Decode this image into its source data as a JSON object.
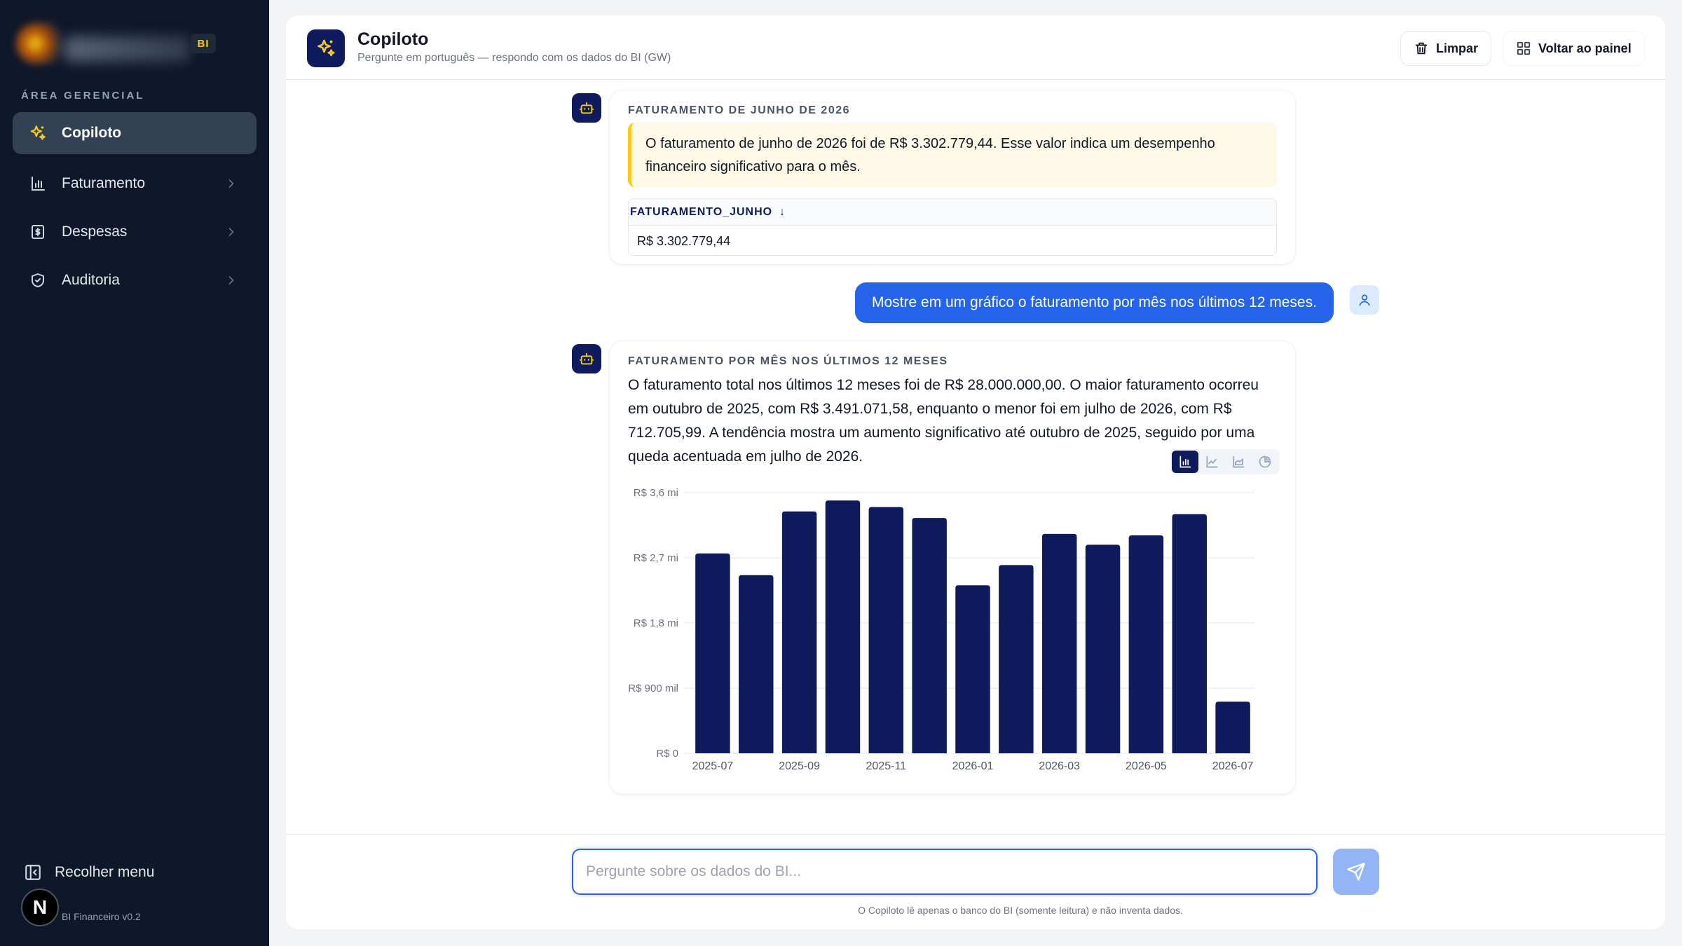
{
  "sidebar": {
    "badge": "BI",
    "section_label": "ÁREA GERENCIAL",
    "items": [
      {
        "label": "Copiloto",
        "icon": "sparkles-icon",
        "active": true
      },
      {
        "label": "Faturamento",
        "icon": "bar-chart-icon",
        "active": false
      },
      {
        "label": "Despesas",
        "icon": "receipt-icon",
        "active": false
      },
      {
        "label": "Auditoria",
        "icon": "shield-check-icon",
        "active": false
      }
    ],
    "collapse_label": "Recolher menu",
    "version": "BI Financeiro v0.2",
    "n_badge": "N"
  },
  "header": {
    "title": "Copiloto",
    "subtitle": "Pergunte em português — respondo com os dados do BI (GW)",
    "clear_label": "Limpar",
    "back_label": "Voltar ao painel"
  },
  "messages": {
    "first": {
      "label": "FATURAMENTO DE JUNHO DE 2026",
      "text": "O faturamento de junho de 2026 foi de R$ 3.302.779,44. Esse valor indica um desempenho financeiro significativo para o mês.",
      "table_header": "FATURAMENTO_JUNHO",
      "sort_indicator": "↓",
      "table_value": "R$ 3.302.779,44"
    },
    "user": {
      "text": "Mostre em um gráfico o faturamento por mês nos últimos 12 meses."
    },
    "second": {
      "label": "FATURAMENTO POR MÊS NOS ÚLTIMOS 12 MESES",
      "text": "O faturamento total nos últimos 12 meses foi de R$ 28.000.000,00. O maior faturamento ocorreu em outubro de 2025, com R$ 3.491.071,58, enquanto o menor foi em julho de 2026, com R$ 712.705,99. A tendência mostra um aumento significativo até outubro de 2025, seguido por uma queda acentuada em julho de 2026."
    }
  },
  "chart_toggle": {
    "options": [
      "bar-chart-icon",
      "line-chart-icon",
      "area-chart-icon",
      "pie-chart-icon"
    ],
    "active": "bar-chart-icon"
  },
  "chart_data": {
    "type": "bar",
    "categories": [
      "2025-07",
      "2025-08",
      "2025-09",
      "2025-10",
      "2025-11",
      "2025-12",
      "2026-01",
      "2026-02",
      "2026-03",
      "2026-04",
      "2026-05",
      "2026-06",
      "2026-07"
    ],
    "x_tick_labels": [
      "2025-07",
      "2025-09",
      "2025-11",
      "2026-01",
      "2026-03",
      "2026-05",
      "2026-07"
    ],
    "values": [
      2760000,
      2460000,
      3340000,
      3491071.58,
      3400000,
      3250000,
      2320000,
      2600000,
      3030000,
      2880000,
      3010000,
      3302779.44,
      712705.99
    ],
    "y_ticks": [
      0,
      900000,
      1800000,
      2700000,
      3600000
    ],
    "y_tick_labels": [
      "R$ 0",
      "R$ 900 mil",
      "R$ 1,8 mi",
      "R$ 2,7 mi",
      "R$ 3,6 mi"
    ],
    "ylim": [
      0,
      3600000
    ],
    "grid": true,
    "color": "#0f1b5c"
  },
  "input": {
    "placeholder": "Pergunte sobre os dados do BI...",
    "value": ""
  },
  "footnote": "O Copiloto lê apenas o banco do BI (somente leitura) e não inventa dados.",
  "colors": {
    "sidebar_bg": "#0f172a",
    "accent": "#2563eb",
    "brand_navy": "#0f1b5c",
    "highlight": "#facc15"
  }
}
